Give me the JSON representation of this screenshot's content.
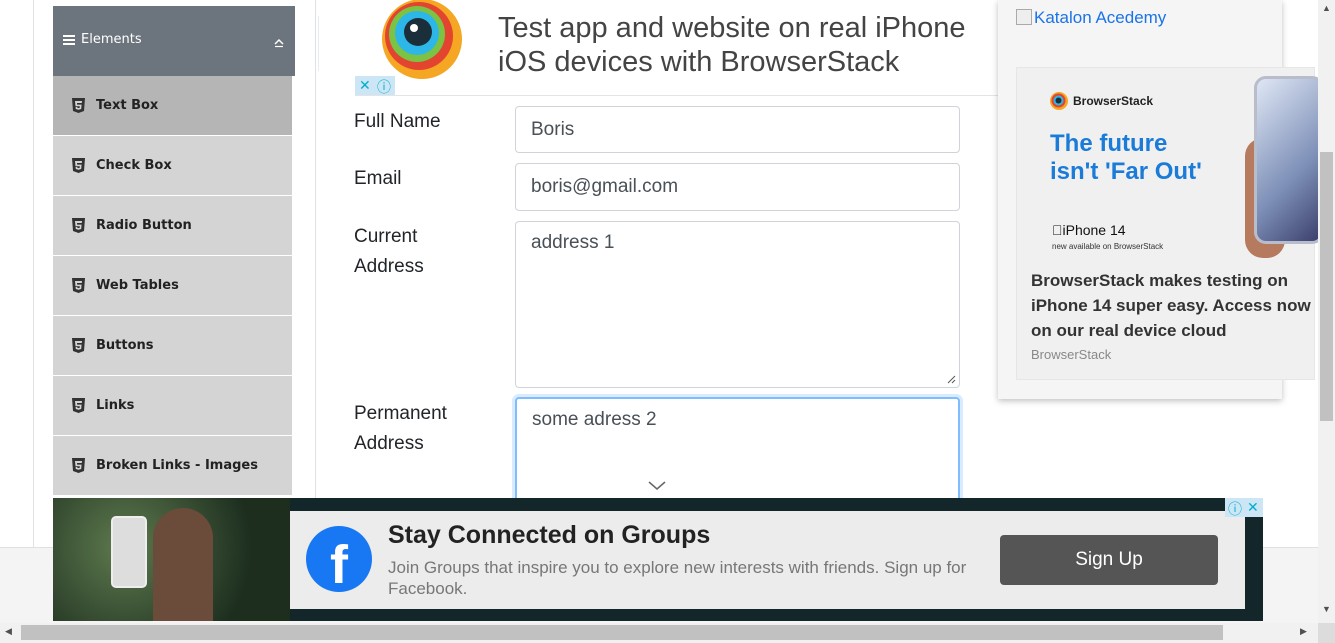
{
  "sidebar": {
    "group_title": "Elements",
    "items": [
      {
        "label": "Text Box",
        "active": true
      },
      {
        "label": "Check Box"
      },
      {
        "label": "Radio Button"
      },
      {
        "label": "Web Tables"
      },
      {
        "label": "Buttons"
      },
      {
        "label": "Links"
      },
      {
        "label": "Broken Links - Images"
      }
    ]
  },
  "top_ad": {
    "line1": "Test app and website on real iPhone",
    "line2": "iOS devices with BrowserStack"
  },
  "form": {
    "full_name": {
      "label": "Full Name",
      "value": "Boris"
    },
    "email": {
      "label": "Email",
      "value": "boris@gmail.com"
    },
    "current_address": {
      "label_line1": "Current",
      "label_line2": "Address",
      "value": "address 1"
    },
    "permanent_address": {
      "label_line1": "Permanent",
      "label_line2": "Address",
      "value": "some adress 2"
    }
  },
  "right_ad": {
    "broken_image_alt": "Katalon Acedemy",
    "brand": "BrowserStack",
    "headline_line1": "The future",
    "headline_line2": "isn't 'Far Out'",
    "product": "iPhone 14",
    "product_sub": "new available on BrowserStack",
    "description": "BrowserStack makes testing on iPhone 14 super easy. Access now on our real device cloud",
    "source": "BrowserStack"
  },
  "bottom_ad": {
    "title": "Stay Connected on Groups",
    "body": "Join Groups that inspire you to explore new interests with friends. Sign up for Facebook.",
    "cta": "Sign Up"
  },
  "colors": {
    "sidebar_header": "#6c757d",
    "menu_item": "#d4d4d4",
    "menu_item_active": "#b5b5b5",
    "ad_headline": "#1a7bd8",
    "facebook_blue": "#1877f2",
    "focus_border": "#80bdff"
  }
}
